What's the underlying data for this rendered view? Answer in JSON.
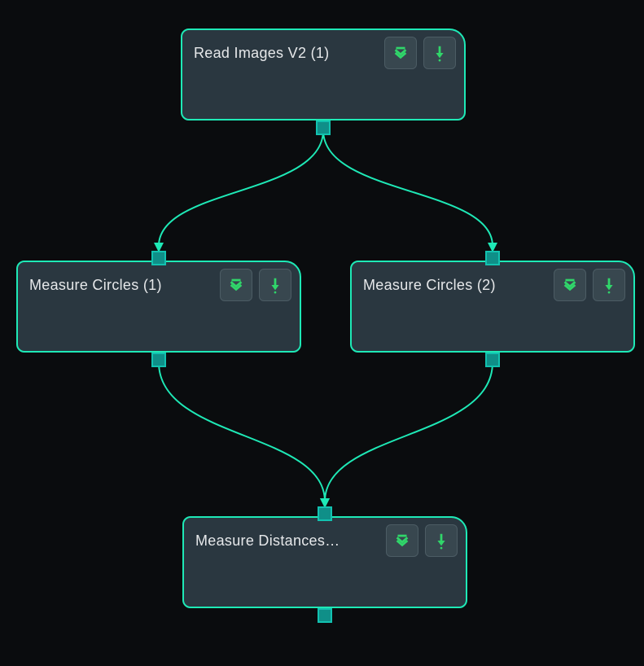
{
  "colors": {
    "background": "#0a0c0e",
    "node_fill": "#2a3740",
    "node_border": "#1ee9b6",
    "wire": "#1ee9b6",
    "port_fill": "#0f8f88",
    "port_border": "#12c2b0",
    "text": "#e6e8ea",
    "button_fill": "#38474f",
    "icon_green": "#30d66a"
  },
  "nodes": {
    "read_images": {
      "title": "Read Images V2 (1)",
      "icons": {
        "expand": "expand-down-icon",
        "run": "run-down-icon"
      }
    },
    "measure_circles_1": {
      "title": "Measure Circles (1)",
      "icons": {
        "expand": "expand-down-icon",
        "run": "run-down-icon"
      }
    },
    "measure_circles_2": {
      "title": "Measure Circles (2)",
      "icons": {
        "expand": "expand-down-icon",
        "run": "run-down-icon"
      }
    },
    "measure_distances": {
      "title": "Measure Distances…",
      "icons": {
        "expand": "expand-down-icon",
        "run": "run-down-icon"
      }
    }
  },
  "edges": [
    {
      "from": "read_images",
      "to": "measure_circles_1"
    },
    {
      "from": "read_images",
      "to": "measure_circles_2"
    },
    {
      "from": "measure_circles_1",
      "to": "measure_distances"
    },
    {
      "from": "measure_circles_2",
      "to": "measure_distances"
    }
  ]
}
